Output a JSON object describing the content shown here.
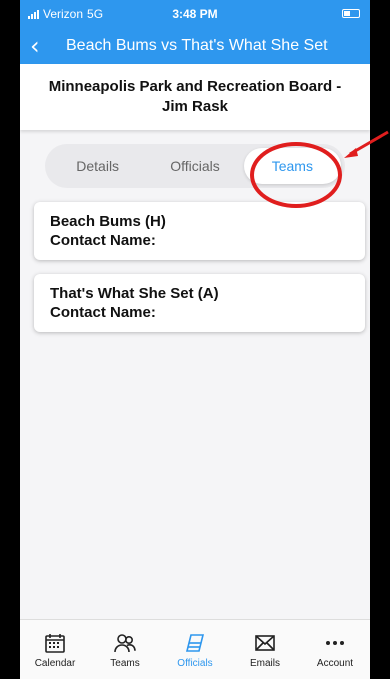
{
  "status_bar": {
    "carrier": "Verizon",
    "network": "5G",
    "time": "3:48 PM"
  },
  "header": {
    "title": "Beach Bums vs That's What She Set"
  },
  "location": {
    "line1": "Minneapolis Park and Recreation Board -",
    "line2": "Jim Rask"
  },
  "segments": [
    {
      "label": "Details",
      "active": false
    },
    {
      "label": "Officials",
      "active": false
    },
    {
      "label": "Teams",
      "active": true
    }
  ],
  "teams": [
    {
      "name": "Beach Bums (H)",
      "contact_label": "Contact Name:",
      "contact_value": ""
    },
    {
      "name": "That's What She Set (A)",
      "contact_label": "Contact Name:",
      "contact_value": ""
    }
  ],
  "tab_bar": [
    {
      "label": "Calendar",
      "icon": "calendar-icon",
      "active": false
    },
    {
      "label": "Teams",
      "icon": "people-icon",
      "active": false
    },
    {
      "label": "Officials",
      "icon": "eraser-icon",
      "active": true
    },
    {
      "label": "Emails",
      "icon": "envelope-icon",
      "active": false
    },
    {
      "label": "Account",
      "icon": "more-icon",
      "active": false
    }
  ],
  "colors": {
    "accent": "#2e97ee",
    "annotation": "#e01e1e"
  }
}
